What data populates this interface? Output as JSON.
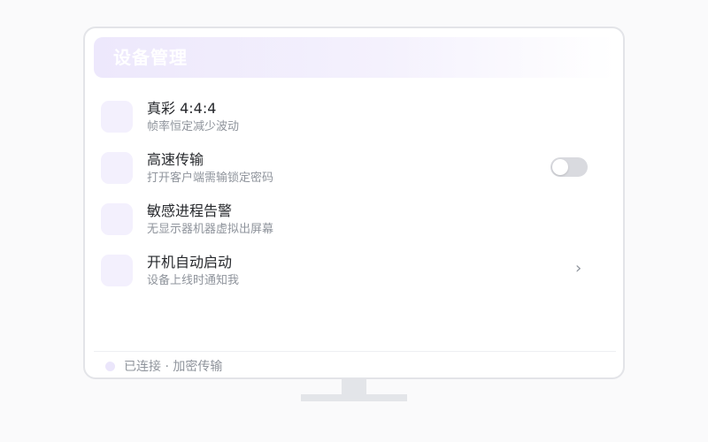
{
  "header": {
    "title": "设备管理"
  },
  "settings": {
    "items": [
      {
        "title": "真彩 4:4:4",
        "subtitle": "帧率恒定减少波动",
        "control": "none"
      },
      {
        "title": "高速传输",
        "subtitle": "打开客户端需输锁定密码",
        "control": "toggle",
        "enabled": false
      },
      {
        "title": "敏感进程告警",
        "subtitle": "无显示器机器虚拟出屏幕",
        "control": "none"
      },
      {
        "title": "开机自动启动",
        "subtitle": "设备上线时通知我",
        "control": "chevron"
      }
    ],
    "chevron_glyph": "›"
  },
  "footer": {
    "status": "已连接 · 加密传输"
  },
  "colors": {
    "accent_light": "#f3f0fd",
    "header_gradient_start": "#ede8fc",
    "toggle_off": "#d9dadf",
    "border": "#e3e4e8"
  }
}
